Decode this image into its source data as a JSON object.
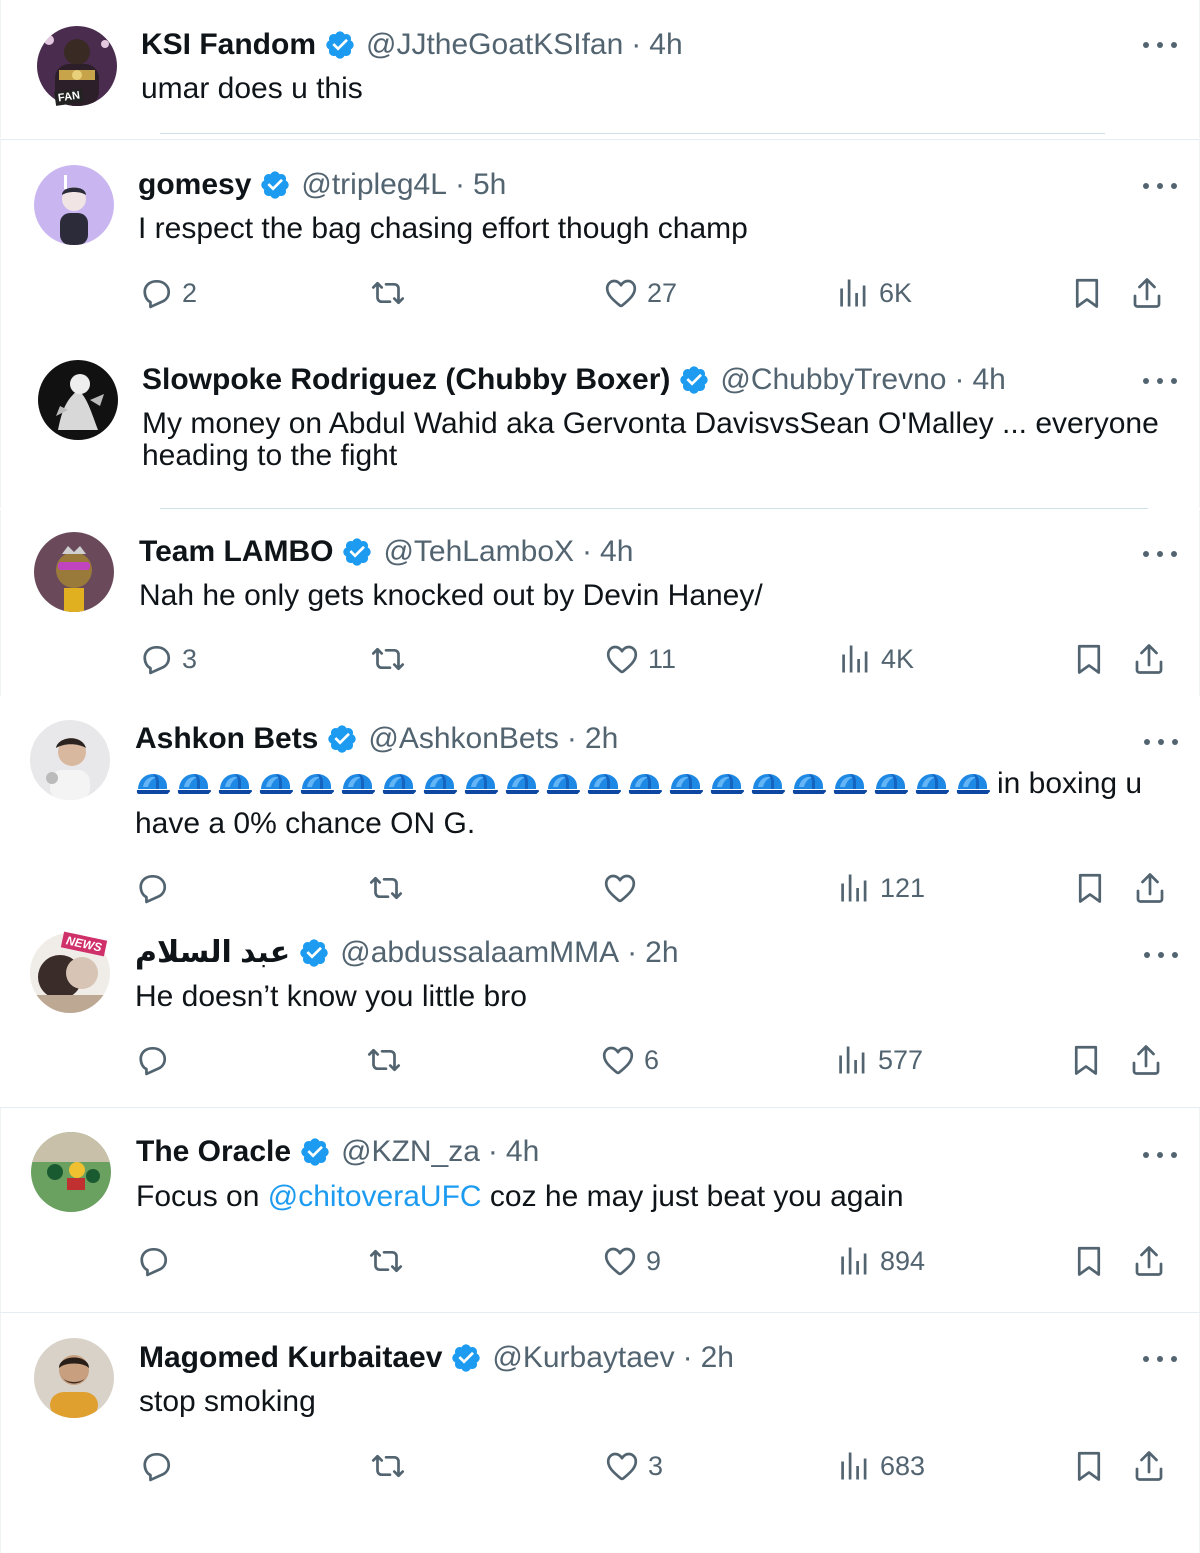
{
  "colors": {
    "text": "#0f1419",
    "muted": "#536471",
    "verified": "#1d9bf0",
    "link": "#1d9bf0",
    "divider": "#e6ecf0"
  },
  "tweets": [
    {
      "name": "KSI Fandom",
      "handle": "@JJtheGoatKSIfan",
      "sep": "·",
      "time": "4h",
      "text": "umar does u this",
      "avatar_label": "FAN",
      "has_actions": false
    },
    {
      "name": "gomesy",
      "handle": "@tripleg4L",
      "sep": "·",
      "time": "5h",
      "text": "I respect the bag chasing effort though champ",
      "replies": "2",
      "likes": "27",
      "views": "6K",
      "has_actions": true
    },
    {
      "name": "Slowpoke Rodriguez (Chubby Boxer)",
      "handle": "@ChubbyTrevno",
      "sep": "·",
      "time": "4h",
      "text_line1": "My money on Abdul Wahid aka Gervonta DavisvsSean O'Malley ... everyone",
      "text_line2": "heading to the fight",
      "has_actions": false
    },
    {
      "name": "Team LAMBO",
      "handle": "@TehLamboX",
      "sep": "·",
      "time": "4h",
      "text": "Nah he only gets knocked out by Devin Haney/",
      "replies": "3",
      "likes": "11",
      "views": "4K",
      "has_actions": true
    },
    {
      "name": "Ashkon Bets",
      "handle": "@AshkonBets",
      "sep": "·",
      "time": "2h",
      "text_line1_suffix": "in boxing u",
      "text_line2": "have a 0% chance ON G.",
      "cap_emoji_count": 21,
      "replies": "",
      "likes": "",
      "views": "121",
      "has_actions": true
    },
    {
      "name": "عبد السلام",
      "handle": "@abdussalaamMMA",
      "sep": "·",
      "time": "2h",
      "text": "He doesn’t know you little bro",
      "avatar_label": "NEWS",
      "replies": "",
      "likes": "6",
      "views": "577",
      "has_actions": true
    },
    {
      "name": "The Oracle",
      "handle": "@KZN_za",
      "sep": "·",
      "time": "4h",
      "text_pre": "Focus on ",
      "mention": "@chitoveraUFC",
      "text_post": " coz he may just beat you again",
      "replies": "",
      "likes": "9",
      "views": "894",
      "has_actions": true
    },
    {
      "name": "Magomed Kurbaitaev",
      "handle": "@Kurbaytaev",
      "sep": "·",
      "time": "2h",
      "text": "stop smoking",
      "replies": "",
      "likes": "3",
      "views": "683",
      "has_actions": true
    }
  ]
}
